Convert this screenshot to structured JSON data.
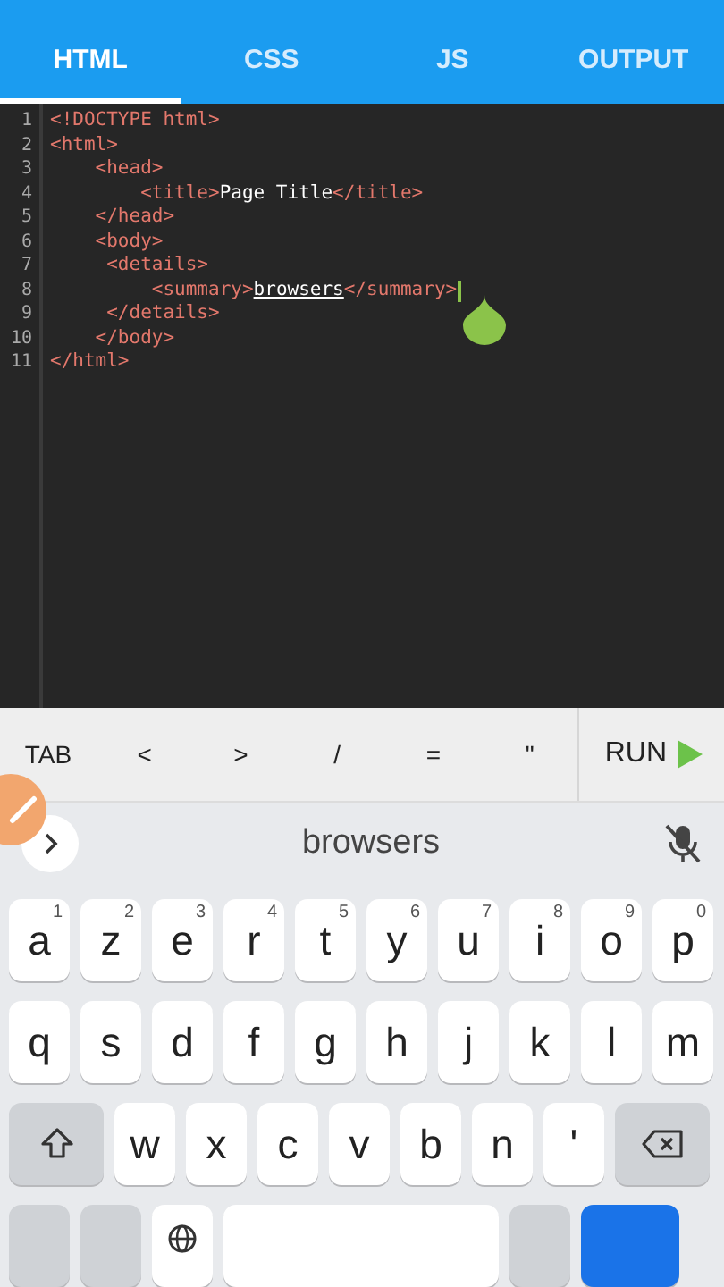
{
  "tabs": [
    {
      "label": "HTML",
      "selected": true
    },
    {
      "label": "CSS",
      "selected": false
    },
    {
      "label": "JS",
      "selected": false
    },
    {
      "label": "OUTPUT",
      "selected": false
    }
  ],
  "editor": {
    "lines": [
      {
        "number": "1",
        "tokens": [
          {
            "kind": "tag",
            "text": "<!DOCTYPE html>"
          }
        ]
      },
      {
        "number": "2",
        "tokens": [
          {
            "kind": "tag",
            "text": "<html>"
          }
        ]
      },
      {
        "number": "3",
        "tokens": [
          {
            "kind": "tag",
            "text": "    <head>"
          }
        ]
      },
      {
        "number": "4",
        "tokens": [
          {
            "kind": "tag",
            "text": "        <title>"
          },
          {
            "kind": "text",
            "text": "Page Title"
          },
          {
            "kind": "tag",
            "text": "</title>"
          }
        ]
      },
      {
        "number": "5",
        "tokens": [
          {
            "kind": "tag",
            "text": "    </head>"
          }
        ]
      },
      {
        "number": "6",
        "tokens": [
          {
            "kind": "tag",
            "text": "    <body>"
          }
        ]
      },
      {
        "number": "7",
        "tokens": [
          {
            "kind": "tag",
            "text": "     <details>"
          }
        ]
      },
      {
        "number": "8",
        "tokens": [
          {
            "kind": "tag",
            "text": "         <summary>"
          },
          {
            "kind": "word",
            "text": "browsers"
          },
          {
            "kind": "tag",
            "text": "</summary>"
          }
        ]
      },
      {
        "number": "9",
        "tokens": [
          {
            "kind": "tag",
            "text": "     </details>"
          }
        ]
      },
      {
        "number": "10",
        "tokens": [
          {
            "kind": "tag",
            "text": "    </body>"
          }
        ]
      },
      {
        "number": "11",
        "tokens": [
          {
            "kind": "tag",
            "text": "</html>"
          }
        ]
      }
    ]
  },
  "accessory_keys": [
    "TAB",
    "<",
    ">",
    "/",
    "=",
    "\""
  ],
  "run_button": "RUN",
  "suggestion": "browsers",
  "keyboard": {
    "rows": [
      [
        {
          "kind": "letter",
          "label": "a",
          "hint": "1"
        },
        {
          "kind": "letter",
          "label": "z",
          "hint": "2"
        },
        {
          "kind": "letter",
          "label": "e",
          "hint": "3"
        },
        {
          "kind": "letter",
          "label": "r",
          "hint": "4"
        },
        {
          "kind": "letter",
          "label": "t",
          "hint": "5"
        },
        {
          "kind": "letter",
          "label": "y",
          "hint": "6"
        },
        {
          "kind": "letter",
          "label": "u",
          "hint": "7"
        },
        {
          "kind": "letter",
          "label": "i",
          "hint": "8"
        },
        {
          "kind": "letter",
          "label": "o",
          "hint": "9"
        },
        {
          "kind": "letter",
          "label": "p",
          "hint": "0"
        }
      ],
      [
        {
          "kind": "letter",
          "label": "q"
        },
        {
          "kind": "letter",
          "label": "s"
        },
        {
          "kind": "letter",
          "label": "d"
        },
        {
          "kind": "letter",
          "label": "f"
        },
        {
          "kind": "letter",
          "label": "g"
        },
        {
          "kind": "letter",
          "label": "h"
        },
        {
          "kind": "letter",
          "label": "j"
        },
        {
          "kind": "letter",
          "label": "k"
        },
        {
          "kind": "letter",
          "label": "l"
        },
        {
          "kind": "letter",
          "label": "m"
        }
      ],
      [
        {
          "kind": "shift"
        },
        {
          "kind": "letter",
          "label": "w"
        },
        {
          "kind": "letter",
          "label": "x"
        },
        {
          "kind": "letter",
          "label": "c"
        },
        {
          "kind": "letter",
          "label": "v"
        },
        {
          "kind": "letter",
          "label": "b"
        },
        {
          "kind": "letter",
          "label": "n"
        },
        {
          "kind": "letter",
          "label": "'"
        },
        {
          "kind": "backspace"
        }
      ],
      [
        {
          "kind": "function"
        },
        {
          "kind": "function"
        },
        {
          "kind": "globe"
        },
        {
          "kind": "space"
        },
        {
          "kind": "function"
        },
        {
          "kind": "action"
        }
      ]
    ]
  }
}
